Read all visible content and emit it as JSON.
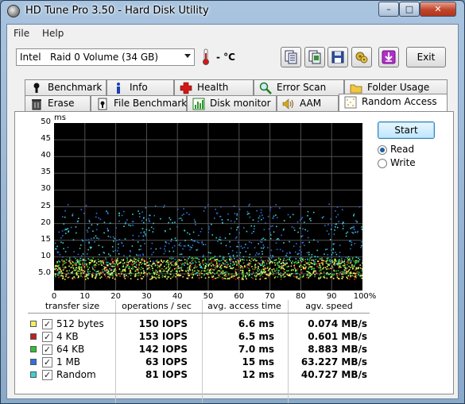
{
  "window": {
    "title": "HD Tune Pro 3.50 - Hard Disk Utility"
  },
  "menu": {
    "file_label": "File",
    "help_label": "Help"
  },
  "toolbar": {
    "drive_vendor": "Intel",
    "drive_name": "Raid 0 Volume (34 GB)",
    "temperature": "- °C",
    "exit_label": "Exit",
    "icons": [
      "copy-text-icon",
      "copy-screen-icon",
      "save-icon",
      "options-icon",
      "download-icon"
    ]
  },
  "tabs": {
    "row_back": [
      {
        "label": "Benchmark",
        "icon": "benchmark-icon"
      },
      {
        "label": "Info",
        "icon": "info-icon"
      },
      {
        "label": "Health",
        "icon": "health-icon"
      },
      {
        "label": "Error Scan",
        "icon": "magnifier-icon"
      },
      {
        "label": "Folder Usage",
        "icon": "folder-icon"
      }
    ],
    "row_front": [
      {
        "label": "Erase",
        "icon": "trash-icon"
      },
      {
        "label": "File Benchmark",
        "icon": "file-benchmark-icon"
      },
      {
        "label": "Disk monitor",
        "icon": "disk-monitor-icon"
      },
      {
        "label": "AAM",
        "icon": "speaker-icon"
      },
      {
        "label": "Random Access",
        "icon": "random-access-icon",
        "active": true
      }
    ]
  },
  "controls": {
    "start_label": "Start",
    "read_label": "Read",
    "write_label": "Write",
    "selected_mode": "Read"
  },
  "chart_data": {
    "type": "scatter",
    "ylabel": "ms",
    "yticks": [
      "50",
      "45",
      "40",
      "35",
      "30",
      "25",
      "20",
      "15",
      "10",
      "5.0"
    ],
    "xticks": [
      "0",
      "10",
      "20",
      "30",
      "40",
      "50",
      "60",
      "70",
      "80",
      "90",
      "100%"
    ],
    "xlim": [
      0,
      100
    ],
    "ylim": [
      0,
      50
    ],
    "grid": true,
    "series": [
      {
        "name": "512 bytes",
        "color": "#f0f060",
        "y_range_ms": [
          3.5,
          9.5
        ]
      },
      {
        "name": "4 KB",
        "color": "#c02020",
        "y_range_ms": [
          3.5,
          9.5
        ]
      },
      {
        "name": "64 KB",
        "color": "#30c030",
        "y_range_ms": [
          4,
          10
        ]
      },
      {
        "name": "1 MB",
        "color": "#3070e0",
        "y_range_ms": [
          8,
          26
        ]
      },
      {
        "name": "Random",
        "color": "#40d0d0",
        "y_range_ms": [
          5,
          24
        ]
      }
    ]
  },
  "results": {
    "headers": [
      "transfer size",
      "operations / sec",
      "avg. access time",
      "agv. speed"
    ],
    "rows": [
      {
        "size": "512 bytes",
        "ops": "150 IOPS",
        "access": "6.6 ms",
        "speed": "0.074 MB/s",
        "color": "#f0f060"
      },
      {
        "size": "4 KB",
        "ops": "153 IOPS",
        "access": "6.5 ms",
        "speed": "0.601 MB/s",
        "color": "#c02020"
      },
      {
        "size": "64 KB",
        "ops": "142 IOPS",
        "access": "7.0 ms",
        "speed": "8.883 MB/s",
        "color": "#30c030"
      },
      {
        "size": "1 MB",
        "ops": "63 IOPS",
        "access": "15 ms",
        "speed": "63.227 MB/s",
        "color": "#3070e0"
      },
      {
        "size": "Random",
        "ops": "81 IOPS",
        "access": "12 ms",
        "speed": "40.727 MB/s",
        "color": "#40d0d0"
      }
    ]
  }
}
